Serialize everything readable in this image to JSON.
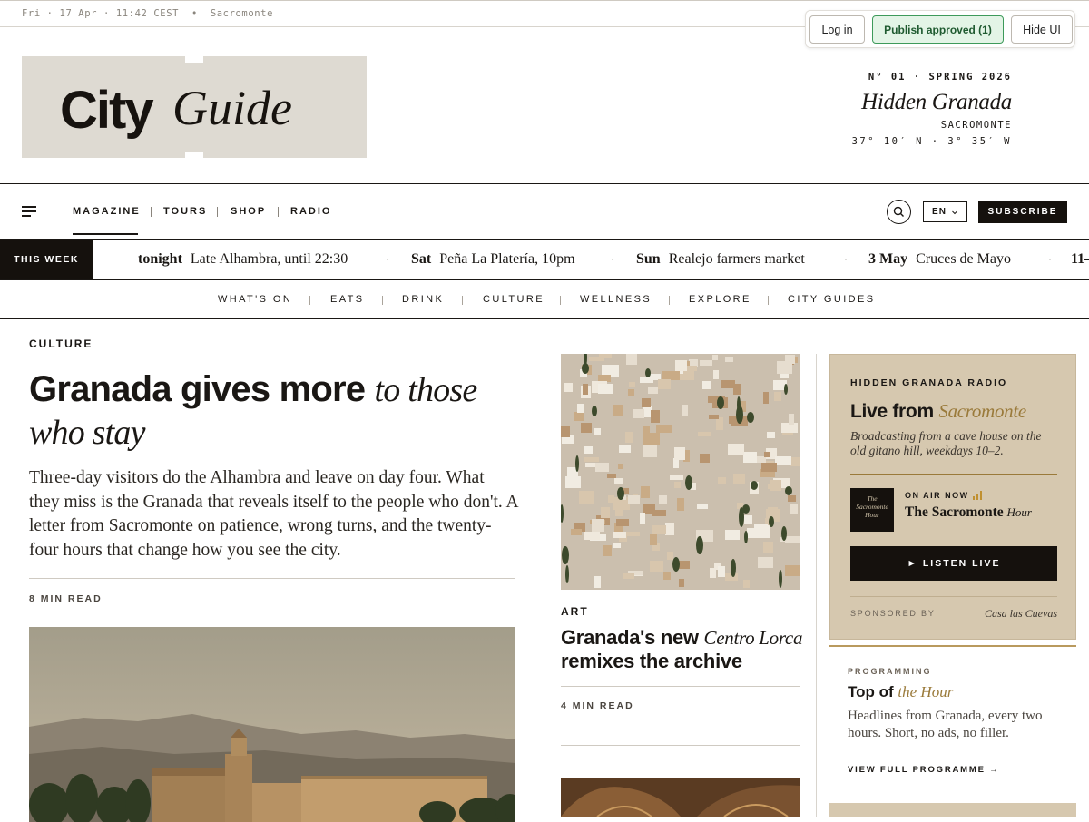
{
  "topbar": {
    "date": "Fri · 17 Apr · 11:42 CEST",
    "bullet": "•",
    "location": "Sacromonte"
  },
  "admin": {
    "login": "Log in",
    "publish": "Publish approved (1)",
    "hide": "Hide UI"
  },
  "brand": {
    "city": "City",
    "guide": "Guide"
  },
  "issue": {
    "number": "N° 01 · SPRING 2026",
    "title": "Hidden Granada",
    "location": "SACROMONTE",
    "coords": "37° 10′ N · 3° 35′ W"
  },
  "nav": {
    "items": [
      "MAGAZINE",
      "TOURS",
      "SHOP",
      "RADIO"
    ],
    "active": "MAGAZINE",
    "lang": "EN",
    "subscribe": "SUBSCRIBE"
  },
  "ticker": {
    "label": "THIS WEEK",
    "items": [
      {
        "when": "tonight",
        "what": "Late Alhambra, until 22:30"
      },
      {
        "when": "Sat",
        "what": "Peña La Platería, 10pm"
      },
      {
        "when": "Sun",
        "what": "Realejo farmers market"
      },
      {
        "when": "3 May",
        "what": "Cruces de Mayo"
      },
      {
        "when": "11–",
        "what": ""
      }
    ]
  },
  "categories": [
    "WHAT'S ON",
    "EATS",
    "DRINK",
    "CULTURE",
    "WELLNESS",
    "EXPLORE",
    "CITY GUIDES"
  ],
  "lead": {
    "kicker": "CULTURE",
    "headline_bold": "Granada gives more",
    "headline_italic": "to those who stay",
    "dek": "Three-day visitors do the Alhambra and leave on day four. What they miss is the Granada that reveals itself to the people who don't. A letter from Sacromonte on patience, wrong turns, and the twenty-four hours that change how you see the city.",
    "readtime": "8 MIN READ"
  },
  "secondary": {
    "kicker": "ART",
    "title_bold": "Granada's new",
    "title_italic": "Centro Lorca",
    "title_rest": "remixes the archive",
    "readtime": "4 MIN READ"
  },
  "radio": {
    "kicker": "HIDDEN GRANADA RADIO",
    "title_bold": "Live from",
    "title_italic": "Sacromonte",
    "desc": "Broadcasting from a cave house on the old gitano hill, weekdays 10–2.",
    "show_art": "The Sacromonte Hour",
    "onair": "ON AIR NOW",
    "show_bold": "The Sacromonte",
    "show_italic": "Hour",
    "listen": "► LISTEN LIVE",
    "sponsor_label": "SPONSORED BY",
    "sponsor": "Casa las Cuevas"
  },
  "programme": {
    "kicker": "PROGRAMMING",
    "title_bold": "Top of",
    "title_italic": "the Hour",
    "desc": "Headlines from Granada, every two hours. Short, no ads, no filler.",
    "link": "VIEW FULL PROGRAMME →"
  },
  "colors": {
    "ink": "#1a1714",
    "logo_bg": "#dedad2",
    "radio_bg": "#d6c8af",
    "accent_gold": "#9a7a3a",
    "publish_green": "#e3f4e6"
  },
  "icons": [
    "menu-icon",
    "search-icon",
    "equalizer-icon",
    "chevron-down-icon"
  ]
}
